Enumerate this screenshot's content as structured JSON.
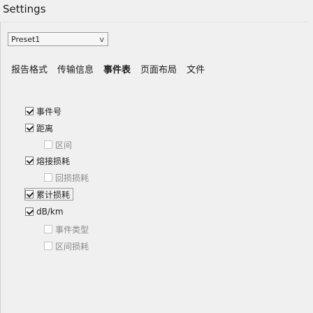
{
  "window": {
    "title": "Settings"
  },
  "preset": {
    "value": "Preset1",
    "arrow": "v"
  },
  "tabs": [
    {
      "label": "报告格式",
      "active": false
    },
    {
      "label": "传输信息",
      "active": false
    },
    {
      "label": "事件表",
      "active": true
    },
    {
      "label": "页面布局",
      "active": false
    },
    {
      "label": "文件",
      "active": false
    }
  ],
  "options": [
    {
      "label": "事件号",
      "checked": true,
      "indent": 0
    },
    {
      "label": "距离",
      "checked": true,
      "indent": 0
    },
    {
      "label": "区间",
      "checked": false,
      "indent": 1
    },
    {
      "label": "熔接损耗",
      "checked": true,
      "indent": 0
    },
    {
      "label": "回损损耗",
      "checked": false,
      "indent": 1
    },
    {
      "label": "累计损耗",
      "checked": true,
      "indent": 0,
      "boxed": true
    },
    {
      "label": "dB/km",
      "checked": true,
      "indent": 0
    },
    {
      "label": "事件类型",
      "checked": false,
      "indent": 1
    },
    {
      "label": "区间损耗",
      "checked": false,
      "indent": 1
    }
  ]
}
